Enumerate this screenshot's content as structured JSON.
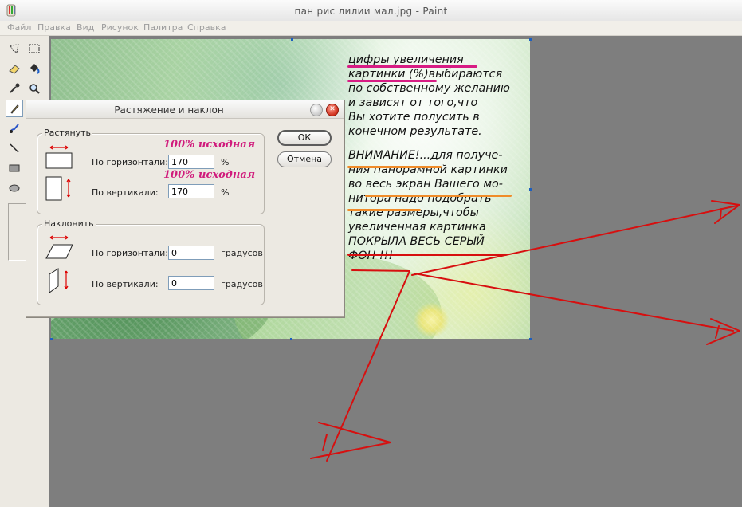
{
  "window": {
    "title": "пан рис лилии мал.jpg - Paint"
  },
  "menu": [
    "Файл",
    "Правка",
    "Вид",
    "Рисунок",
    "Палитра",
    "Справка"
  ],
  "tools": [
    "free-select-icon",
    "rect-select-icon",
    "eraser-icon",
    "fill-bucket-icon",
    "eyedropper-icon",
    "magnifier-icon",
    "pencil-icon",
    "brush-icon",
    "airbrush-icon",
    "text-icon",
    "line-icon",
    "curve-icon",
    "rectangle-icon",
    "polygon-icon",
    "ellipse-icon",
    "rounded-rect-icon"
  ],
  "annotation": {
    "lines": [
      "цифры увеличения",
      "картинки (%)выбираются",
      "по собственному желанию",
      "и зависят от того,что",
      "Вы хотите полусить в",
      "конечном результате.",
      "",
      "ВНИМАНИЕ!...для получе-",
      "ния панорамной картинки",
      "во весь экран Вашего мо-",
      "нитора надо подобрать",
      "такие размеры,чтобы",
      "увеличенная картинка",
      "ПОКРЫЛА ВЕСЬ СЕРЫЙ",
      "ФОН !!!"
    ]
  },
  "dialog": {
    "title": "Растяжение и наклон",
    "stretch": {
      "legend": "Растянуть",
      "horizontal_label": "По горизонтали:",
      "horizontal_value": "170",
      "horizontal_unit": "%",
      "vertical_label": "По вертикали:",
      "vertical_value": "170",
      "vertical_unit": "%",
      "note_h": "100% исходная",
      "note_v": "100% исходная"
    },
    "skew": {
      "legend": "Наклонить",
      "horizontal_label": "По горизонтали:",
      "horizontal_value": "0",
      "horizontal_unit": "градусов",
      "vertical_label": "По вертикали:",
      "vertical_value": "0",
      "vertical_unit": "градусов"
    },
    "ok_label": "ОК",
    "cancel_label": "Отмена"
  },
  "colors": {
    "annotation_red": "#d70f0f",
    "underline_magenta": "#d81c84",
    "underline_orange": "#f08c2a",
    "workspace": "#7e7e7e"
  }
}
